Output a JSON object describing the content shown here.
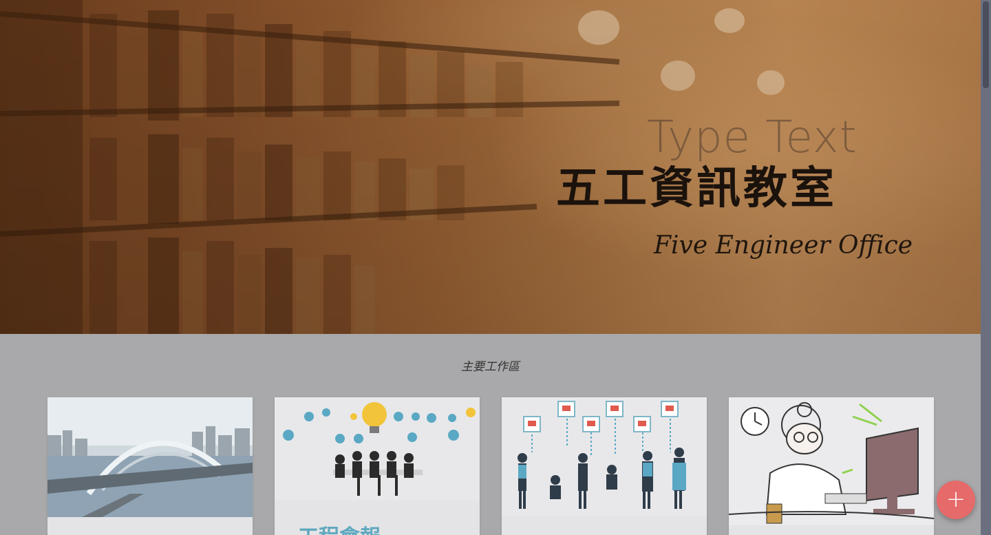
{
  "hero": {
    "line1": "Type Text",
    "line2": "五工資訊教室",
    "line3": "Five Engineer Office"
  },
  "section": {
    "title": "主要工作區"
  },
  "cards": [
    {
      "image": "bridge-illustration",
      "title": ""
    },
    {
      "image": "meeting-infographic",
      "title": "工程會報"
    },
    {
      "image": "people-network-illustration",
      "title": ""
    },
    {
      "image": "woman-at-computer-illustration",
      "title": ""
    }
  ],
  "fab": {
    "icon": "plus-icon",
    "label": "+"
  },
  "colors": {
    "fab": "#e66a6a",
    "card_title": "#5fa8bf",
    "page_bg": "#a9a9ab"
  }
}
